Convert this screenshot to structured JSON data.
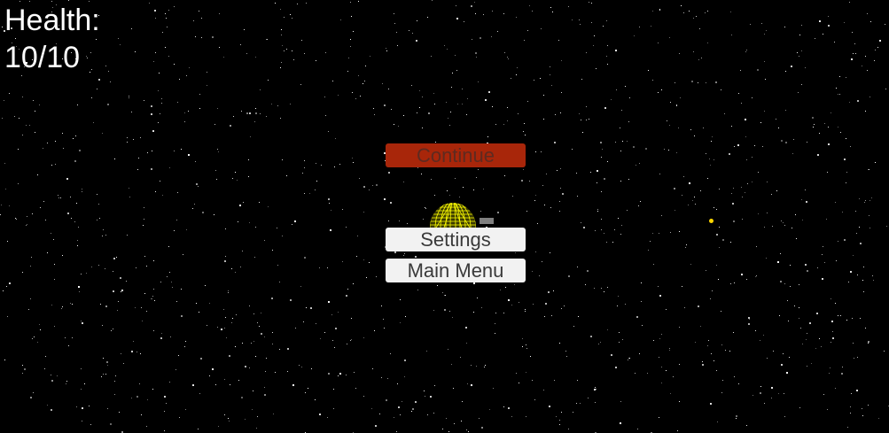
{
  "hud": {
    "health_label": "Health:",
    "health_value": "10/10",
    "health_fraction": 1.0
  },
  "pause_menu": {
    "continue_label": "Continue",
    "settings_label": "Settings",
    "main_menu_label": "Main Menu"
  },
  "colors": {
    "background": "#000000",
    "continue_button": "#a8260a",
    "secondary_buttons": "#f2f2f2",
    "player_wireframe": "#ffff00",
    "enemy_dot": "#ffd700"
  },
  "objects": {
    "player_icon": "wireframe-sphere-icon",
    "gun_icon": "gun-barrel-icon",
    "enemy_icon": "yellow-dot-icon"
  }
}
